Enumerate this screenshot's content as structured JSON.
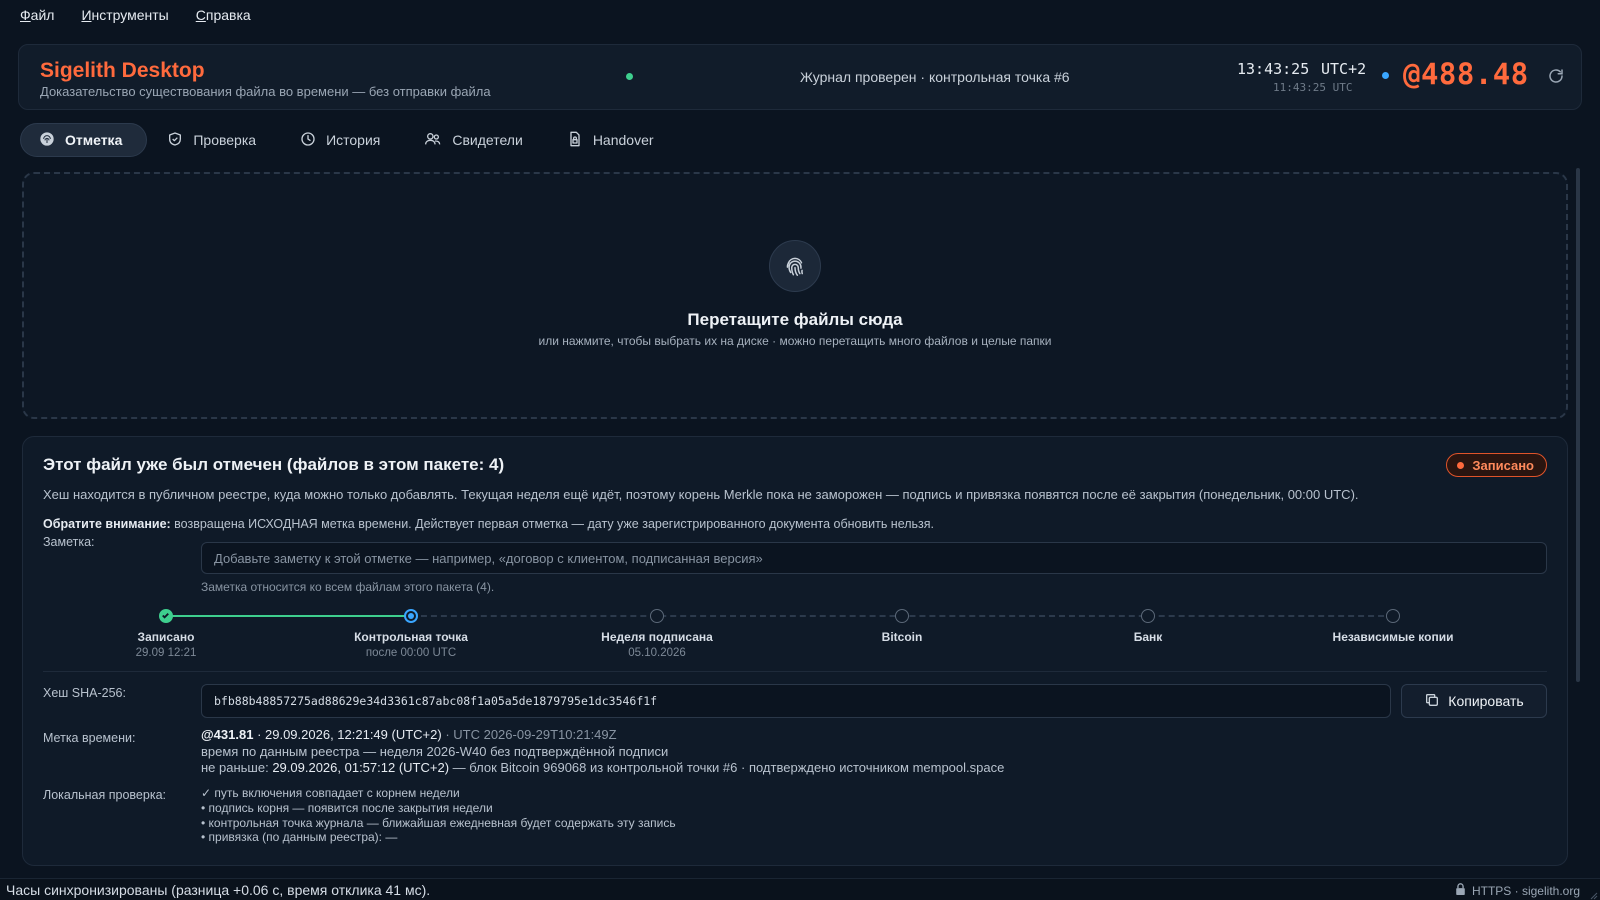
{
  "menu": {
    "file": "Файл",
    "tools": "Инструменты",
    "help": "Справка"
  },
  "header": {
    "title": "Sigelith Desktop",
    "subtitle": "Доказательство существования файла во времени — без отправки файла",
    "journal_status": "Журнал проверен · контрольная точка #6",
    "clock_local": "13:43:25",
    "clock_tz": "UTC+2",
    "clock_utc": "11:43:25 UTC",
    "beat": "@488.48"
  },
  "tabs": [
    {
      "label": "Отметка",
      "icon": "fingerprint-icon",
      "active": true
    },
    {
      "label": "Проверка",
      "icon": "shield-check-icon"
    },
    {
      "label": "История",
      "icon": "clock-icon"
    },
    {
      "label": "Свидетели",
      "icon": "users-icon"
    },
    {
      "label": "Handover",
      "icon": "file-lock-icon"
    }
  ],
  "dropzone": {
    "title": "Перетащите файлы сюда",
    "hint": "или нажмите, чтобы выбрать их на диске · можно перетащить много файлов и целые папки"
  },
  "result": {
    "title": "Этот файл уже был отмечен (файлов в этом пакете: 4)",
    "badge": "Записано",
    "description": "Хеш находится в публичном реестре, куда можно только добавлять. Текущая неделя ещё идёт, поэтому корень Merkle пока не заморожен — подпись и привязка появятся после её закрытия (понедельник, 00:00 UTC).",
    "note_bold": "Обратите внимание:",
    "note_text": " возвращена ИСХОДНАЯ метка времени. Действует первая отметка — дату уже зарегистрированного документа обновить нельзя.",
    "note_label": "Заметка:",
    "note_placeholder": "Добавьте заметку к этой отметке — например, «договор с клиентом, подписанная версия»",
    "note_help": "Заметка относится ко всем файлам этого пакета (4).",
    "timeline": [
      {
        "label": "Записано",
        "sub": "29.09 12:21",
        "state": "done"
      },
      {
        "label": "Контрольная точка",
        "sub": "после 00:00 UTC",
        "state": "current"
      },
      {
        "label": "Неделя подписана",
        "sub": "05.10.2026",
        "state": "pending"
      },
      {
        "label": "Bitcoin",
        "sub": "",
        "state": "pending"
      },
      {
        "label": "Банк",
        "sub": "",
        "state": "pending"
      },
      {
        "label": "Независимые копии",
        "sub": "",
        "state": "pending"
      }
    ],
    "hash_label": "Хеш SHA-256:",
    "hash": "bfb88b48857275ad88629e34d3361c87abc08f1a05a5de1879795e1dc3546f1f",
    "copy_label": "Копировать",
    "ts_label": "Метка времени:",
    "ts_beat": "@431.81",
    "ts_local": " · 29.09.2026, 12:21:49 (UTC+2)",
    "ts_utc": " · UTC 2026-09-29T10:21:49Z",
    "ts_line2": "время по данным реестра — неделя 2026-W40 без подтверждённой подписи",
    "ts_line3_prefix": "не раньше: ",
    "ts_line3_date": "29.09.2026, 01:57:12 (UTC+2)",
    "ts_line3_rest": " — блок Bitcoin 969068 из контрольной точки #6 · подтверждено источником mempool.space",
    "local_label": "Локальная проверка:",
    "checks": [
      "✓ путь включения совпадает с корнем недели",
      "• подпись корня — появится после закрытия недели",
      "• контрольная точка журнала — ближайшая ежедневная будет содержать эту запись",
      "• привязка (по данным реестра): —"
    ]
  },
  "statusbar": {
    "text": "Часы синхронизированы (разница +0.06 с, время отклика 41 мс).",
    "secure": "HTTPS · sigelith.org"
  },
  "colors": {
    "accent": "#ff6a3d",
    "success": "#3ecf8e",
    "info": "#3aa6ff"
  }
}
